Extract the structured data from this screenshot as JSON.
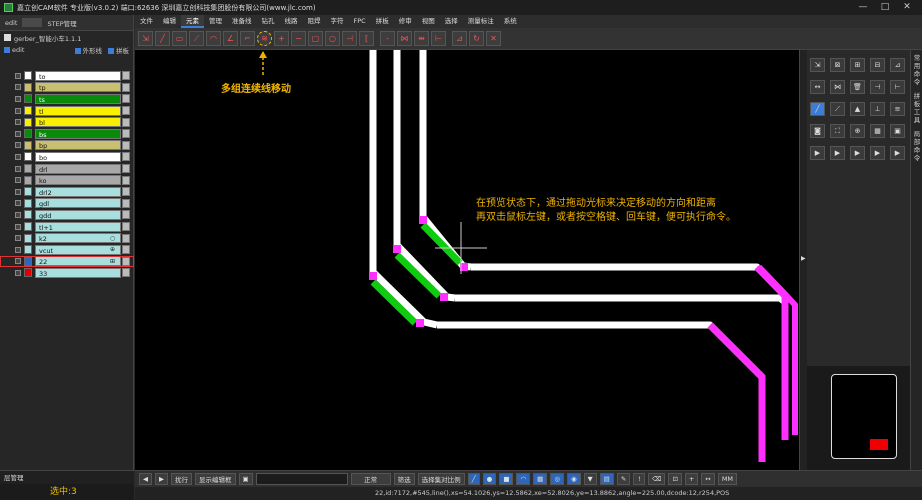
{
  "app": {
    "title": "嘉立创CAM软件 专业版(v3.0.2) 端口:62636    深圳嘉立创科技集团股份有限公司(www.jlc.com)",
    "window_controls": [
      "—",
      "□",
      "✕"
    ]
  },
  "left_panel": {
    "tabs": [
      "edit",
      "STEP管理"
    ],
    "file_name": "gerber_智能小车1.1.1",
    "step_name": "edit",
    "options": [
      "外形线",
      "拼板"
    ],
    "layers": [
      {
        "name": "to",
        "color": "#ffffff",
        "swatch": "#ffffff"
      },
      {
        "name": "tp",
        "color": "#c8c070",
        "swatch": "#c8c070"
      },
      {
        "name": "ts",
        "color": "#0a8a0a",
        "swatch": "#0a8a0a"
      },
      {
        "name": "tl",
        "color": "#f8f000",
        "swatch": "#f8f000"
      },
      {
        "name": "bl",
        "color": "#f8f000",
        "swatch": "#f8f000"
      },
      {
        "name": "bs",
        "color": "#0a8a0a",
        "swatch": "#0a8a0a"
      },
      {
        "name": "bp",
        "color": "#c8c070",
        "swatch": "#c8c070"
      },
      {
        "name": "bo",
        "color": "#ffffff",
        "swatch": "#ffffff"
      },
      {
        "name": "drl",
        "color": "#a8a8a8",
        "swatch": "#a8a8a8"
      },
      {
        "name": "ko",
        "color": "#a8a8a8",
        "swatch": "#a8a8a8"
      },
      {
        "name": "drl2",
        "color": "#a9dede",
        "swatch": "#a9dede"
      },
      {
        "name": "gdl",
        "color": "#a9dede",
        "swatch": "#a9dede"
      },
      {
        "name": "gdd",
        "color": "#a9dede",
        "swatch": "#a9dede"
      },
      {
        "name": "tl+1",
        "color": "#a9dede",
        "swatch": "#a9dede"
      },
      {
        "name": "k2",
        "color": "#a9dede",
        "swatch": "#a9dede",
        "symbol": "○"
      },
      {
        "name": "vcut",
        "color": "#a9dede",
        "swatch": "#a9dede",
        "symbol": "⊕"
      },
      {
        "name": "22",
        "color": "#a9dede",
        "swatch": "#2f66b8",
        "symbol": "⊞",
        "selected": true
      },
      {
        "name": "33",
        "color": "#a9dede",
        "swatch": "#e00000"
      }
    ],
    "bottom_label": "层管理",
    "selection_count": "选中:3"
  },
  "menu": {
    "items": [
      "文件",
      "编辑",
      "元素",
      "管理",
      "准备线",
      "钻孔",
      "线路",
      "阻焊",
      "字符",
      "FPC",
      "拼板",
      "修审",
      "视图",
      "选择",
      "测量标注",
      "系统"
    ],
    "active": "元素"
  },
  "toolbar": {
    "icons": [
      "move-icon",
      "line-icon",
      "pad-icon",
      "slant-icon",
      "arc-icon",
      "angle-icon",
      "corner-icon",
      "multi-line-move-icon",
      "add-icon",
      "minus-icon",
      "outline-icon",
      "circle-icon",
      "split-icon",
      "bracket-icon",
      "dash-icon",
      "mirror-icon",
      "align-icon",
      "snap-icon",
      "measure-icon",
      "rotate-icon",
      "delete-icon"
    ],
    "highlighted": "multi-line-move-icon"
  },
  "annotations": {
    "tool_label": "多组连续线移动",
    "hint_line1": "在预览状态下，通过拖动光标来决定移动的方向和距离",
    "hint_line2": "再双击鼠标左键，或者按空格键、回车键，便可执行命令。"
  },
  "right_panel": {
    "vertical_tabs": [
      "常用命令",
      "拼板工具",
      "局部命令"
    ]
  },
  "bottom_toolbar": {
    "zoom_label": "扰行",
    "display_label": "显示编辑框",
    "mode_label": "正常",
    "filter_label": "筛选",
    "select_label": "选择集对比例",
    "unit": "MM"
  },
  "status": {
    "text": "22,id:7172,#545,line(),xs=54.1026,ys=12.5862,xe=52.8026,ye=13.8862,angle=225.00,dcode:12,r254,POS"
  },
  "colors": {
    "trace": "#ffffff",
    "selected_trace": "#ff30ff",
    "highlight": "#10cc10",
    "annotation": "#f0b400"
  }
}
